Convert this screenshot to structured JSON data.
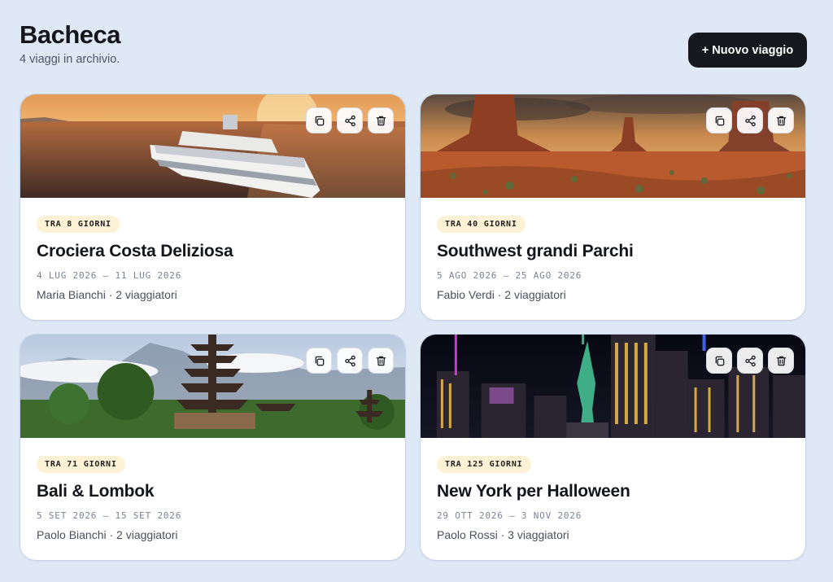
{
  "header": {
    "title": "Bacheca",
    "subtitle": "4 viaggi in archivio.",
    "new_trip_label": "+ Nuovo viaggio"
  },
  "trips": [
    {
      "badge": "TRA 8 GIORNI",
      "title": "Crociera Costa Deliziosa",
      "dates": "4 LUG 2026 – 11 LUG 2026",
      "meta": "Maria Bianchi · 2 viaggiatori",
      "image": "cruise-ship-sunset"
    },
    {
      "badge": "TRA 40 GIORNI",
      "title": "Southwest grandi Parchi",
      "dates": "5 AGO 2026 – 25 AGO 2026",
      "meta": "Fabio Verdi · 2 viaggiatori",
      "image": "monument-valley-desert"
    },
    {
      "badge": "TRA 71 GIORNI",
      "title": "Bali & Lombok",
      "dates": "5 SET 2026 – 15 SET 2026",
      "meta": "Paolo Bianchi · 2 viaggiatori",
      "image": "bali-temple-pagoda"
    },
    {
      "badge": "TRA 125 GIORNI",
      "title": "New York per Halloween",
      "dates": "29 OTT 2026 – 3 NOV 2026",
      "meta": "Paolo Rossi · 3 viaggiatori",
      "image": "new-york-skyline-night"
    }
  ],
  "actions": {
    "duplicate_icon": "copy-icon",
    "share_icon": "share-icon",
    "delete_icon": "trash-icon"
  },
  "colors": {
    "background": "#dfe8f5",
    "primary_button": "#16181d",
    "badge_bg": "#fdf2d6"
  }
}
